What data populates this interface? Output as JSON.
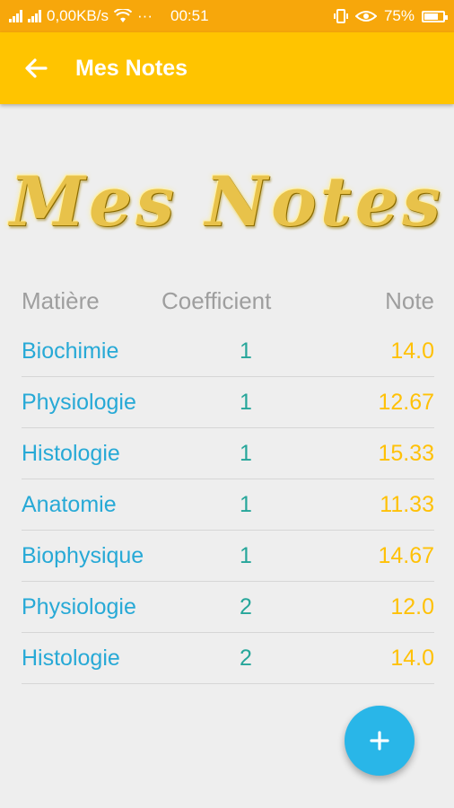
{
  "status_bar": {
    "network_speed": "0,00KB/s",
    "dots": "···",
    "time": "00:51",
    "battery": "75%",
    "battery_level": 0.75
  },
  "app_bar": {
    "title": "Mes Notes"
  },
  "banner": {
    "text": "Mes Notes"
  },
  "table": {
    "headers": [
      "Matière",
      "Coefficient",
      "Note"
    ],
    "rows": [
      {
        "matiere": "Biochimie",
        "coefficient": "1",
        "note": "14.0"
      },
      {
        "matiere": "Physiologie",
        "coefficient": "1",
        "note": "12.67"
      },
      {
        "matiere": "Histologie",
        "coefficient": "1",
        "note": "15.33"
      },
      {
        "matiere": "Anatomie",
        "coefficient": "1",
        "note": "11.33"
      },
      {
        "matiere": "Biophysique",
        "coefficient": "1",
        "note": "14.67"
      },
      {
        "matiere": "Physiologie",
        "coefficient": "2",
        "note": "12.0"
      },
      {
        "matiere": "Histologie",
        "coefficient": "2",
        "note": "14.0"
      }
    ]
  },
  "fab": {
    "icon": "plus-icon"
  },
  "colors": {
    "status_bar": "#F7A70B",
    "app_bar": "#FFC400",
    "subject": "#27A9D6",
    "coefficient": "#26A69A",
    "note": "#FFC107",
    "fab": "#29B6E8"
  }
}
